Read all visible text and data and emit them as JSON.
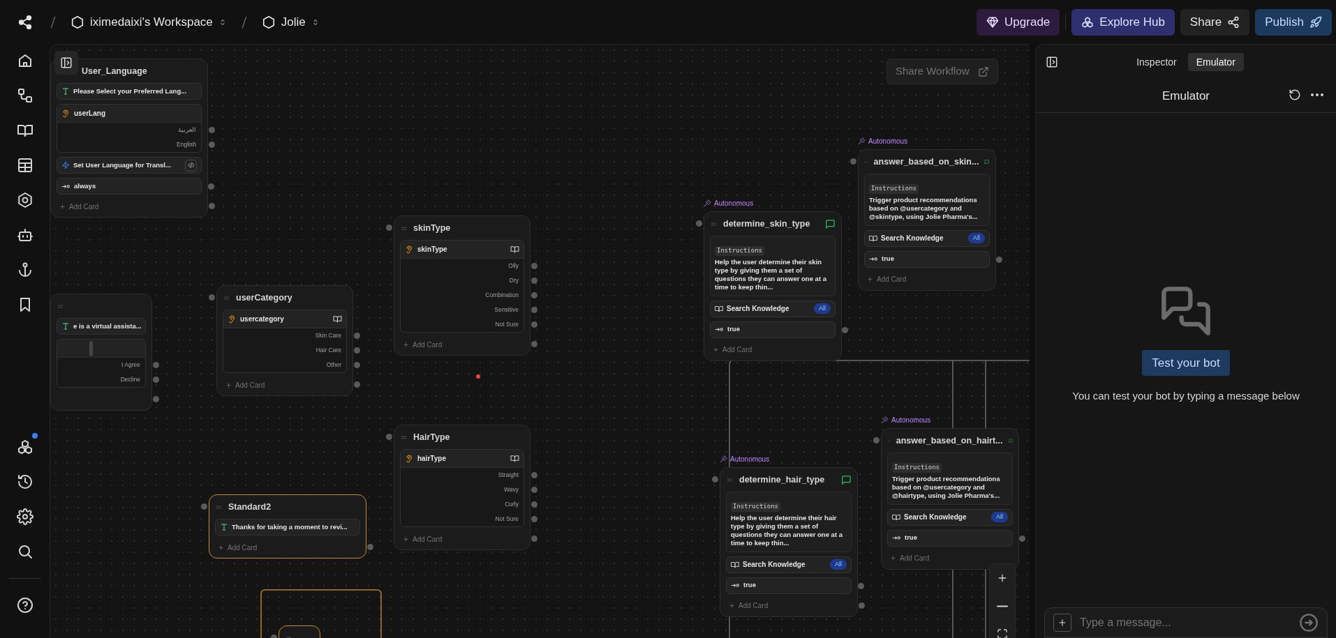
{
  "topbar": {
    "workspace": "iximedaixi's Workspace",
    "bot": "Jolie",
    "buttons": [
      {
        "kind": "upgrade",
        "label": "Upgrade"
      },
      {
        "kind": "hub",
        "label": "Explore Hub"
      },
      {
        "kind": "share",
        "label": "Share"
      },
      {
        "kind": "publish",
        "label": "Publish"
      }
    ]
  },
  "sidebar": {
    "notification": true
  },
  "canvas": {
    "share_workflow": "Share Workflow",
    "nodes": [
      {
        "kind": "standard",
        "title": "User_Language",
        "highlighted": false,
        "fallback_port": true,
        "cards": [
          {
            "kind": "text",
            "text": "Please Select your Preferred Lang..."
          },
          {
            "kind": "capture",
            "label": "userLang",
            "options": [
              "العربية",
              "English"
            ]
          },
          {
            "kind": "code",
            "text": "Set User Language for Transl..."
          },
          {
            "kind": "transition",
            "text": "always"
          }
        ],
        "add_card": "Add Card"
      },
      {
        "kind": "standard",
        "highlighted": false,
        "fallback_port": true,
        "cards": [
          {
            "kind": "text",
            "text": "e is a virtual assista..."
          },
          {
            "kind": "capture",
            "options": [
              "I Agree",
              "Decline"
            ]
          }
        ]
      },
      {
        "kind": "standard",
        "title": "userCategory",
        "highlighted": false,
        "fallback_port": true,
        "cards": [
          {
            "kind": "capture",
            "label": "usercategory",
            "options": [
              "Skin Care",
              "Hair Care",
              "Other"
            ]
          }
        ],
        "add_card": "Add Card"
      },
      {
        "kind": "standard",
        "title": "skinType",
        "highlighted": false,
        "fallback_port": true,
        "cards": [
          {
            "kind": "capture",
            "label": "skinType",
            "options": [
              "Oily",
              "Dry",
              "Combination",
              "Sensitive",
              "Not Sure"
            ]
          }
        ],
        "add_card": "Add Card"
      },
      {
        "kind": "standard",
        "title": "HairType",
        "highlighted": false,
        "fallback_port": true,
        "cards": [
          {
            "kind": "capture",
            "label": "hairType",
            "options": [
              "Straight",
              "Wavy",
              "Curly",
              "Not Sure"
            ]
          }
        ],
        "add_card": "Add Card"
      },
      {
        "kind": "autonomous",
        "badge": "Autonomous",
        "title": "determine_skin_type",
        "highlighted": false,
        "cards": [
          {
            "kind": "instructions",
            "label": "Instructions",
            "text": "Help the user determine their skin type by giving them a set of questions they can answer one at a time to keep thin..."
          },
          {
            "kind": "knowledge",
            "text": "Search Knowledge",
            "scope": "All"
          },
          {
            "kind": "transition",
            "text": "true"
          }
        ],
        "add_card": "Add Card"
      },
      {
        "kind": "autonomous",
        "badge": "Autonomous",
        "title": "answer_based_on_skin...",
        "highlighted": false,
        "cards": [
          {
            "kind": "instructions",
            "label": "Instructions",
            "text": "Trigger product recommendations based on @usercategory and @skintype, using Jolie Pharma's..."
          },
          {
            "kind": "knowledge",
            "text": "Search Knowledge",
            "scope": "All"
          },
          {
            "kind": "transition",
            "text": "true"
          }
        ],
        "add_card": "Add Card"
      },
      {
        "kind": "autonomous",
        "badge": "Autonomous",
        "title": "determine_hair_type",
        "highlighted": false,
        "fallback_port": true,
        "cards": [
          {
            "kind": "instructions",
            "label": "Instructions",
            "text": "Help the user determine their hair type by giving them a set of questions they can answer one at a time to keep thin..."
          },
          {
            "kind": "knowledge",
            "text": "Search Knowledge",
            "scope": "All"
          },
          {
            "kind": "transition",
            "text": "true"
          }
        ],
        "add_card": "Add Card"
      },
      {
        "kind": "autonomous",
        "badge": "Autonomous",
        "title": "answer_based_on_hairt...",
        "highlighted": false,
        "cards": [
          {
            "kind": "instructions",
            "label": "Instructions",
            "text": "Trigger product recommendations based on @usercategory and @hairtype, using Jolie Pharma's..."
          },
          {
            "kind": "knowledge",
            "text": "Search Knowledge",
            "scope": "All"
          },
          {
            "kind": "transition",
            "text": "true"
          }
        ],
        "add_card": "Add Card"
      },
      {
        "kind": "standard",
        "title": "Standard2",
        "highlighted": true,
        "fallback_port": true,
        "cards": [
          {
            "kind": "text",
            "text": "Thanks for taking a moment to revi..."
          }
        ],
        "add_card": "Add Card"
      },
      {
        "kind": "standard",
        "highlighted": true
      }
    ]
  },
  "panel": {
    "tabs": [
      {
        "label": "Inspector",
        "selected": false
      },
      {
        "label": "Emulator",
        "selected": true
      }
    ],
    "title": "Emulator",
    "test_button": "Test your bot",
    "hint": "You can test your bot by typing a message below",
    "input": {
      "placeholder": "Type a message..."
    }
  }
}
